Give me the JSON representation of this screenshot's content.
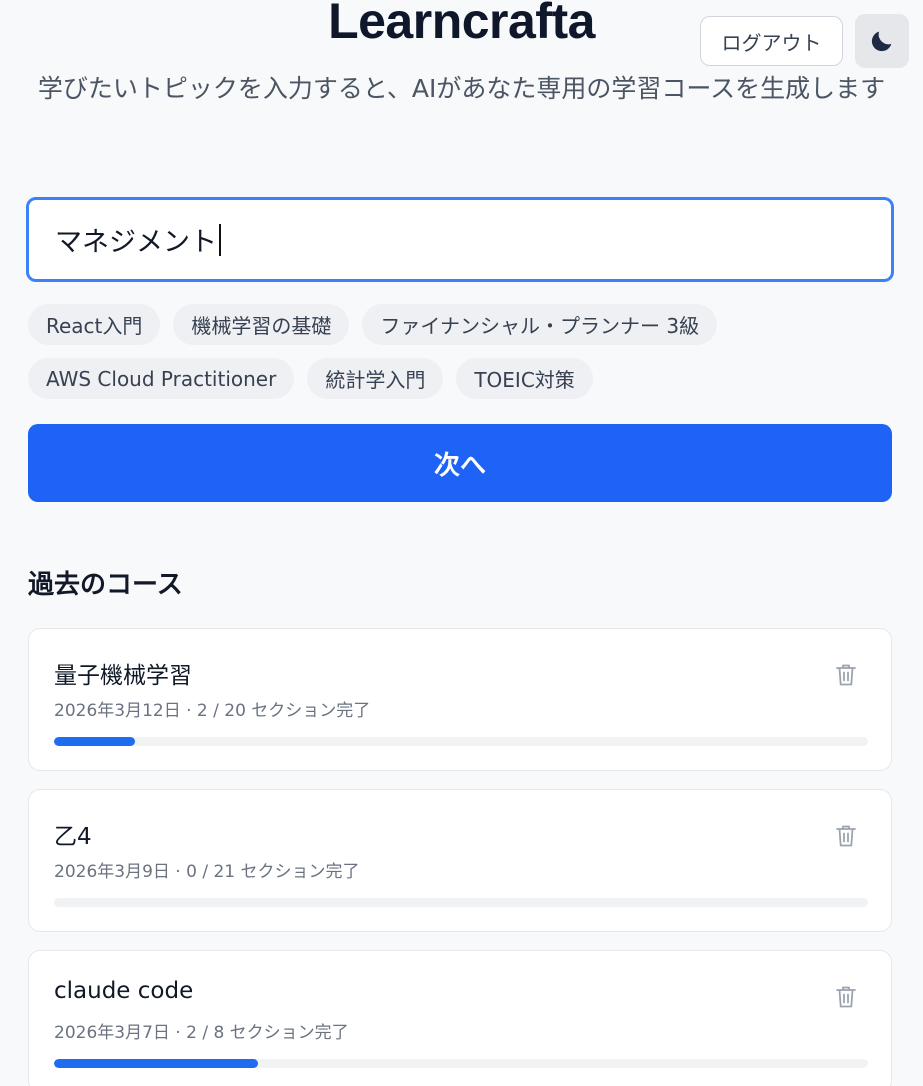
{
  "app": {
    "title": "Learncrafta",
    "subtitle": "学びたいトピックを入力すると、AIがあなた専用の学習コースを生成します"
  },
  "header": {
    "logout_label": "ログアウト",
    "theme_icon": "moon-icon"
  },
  "topic_input": {
    "value": "マネジメント"
  },
  "suggestions": [
    "React入門",
    "機械学習の基礎",
    "ファイナンシャル・プランナー 3級",
    "AWS Cloud Practitioner",
    "統計学入門",
    "TOEIC対策"
  ],
  "next_label": "次へ",
  "past_courses": {
    "heading": "過去のコース",
    "courses": [
      {
        "title": "量子機械学習",
        "meta": "2026年3月12日 · 2 / 20 セクション完了",
        "progress": 0.1
      },
      {
        "title": "乙4",
        "meta": "2026年3月9日 · 0 / 21 セクション完了",
        "progress": 0
      },
      {
        "title": "claude code",
        "meta": "2026年3月7日 · 2 / 8 セクション完了",
        "progress": 0.25
      }
    ]
  },
  "colors": {
    "accent": "#1e63f5",
    "progress": "#1e6cf0",
    "input_border": "#3b82f6"
  }
}
